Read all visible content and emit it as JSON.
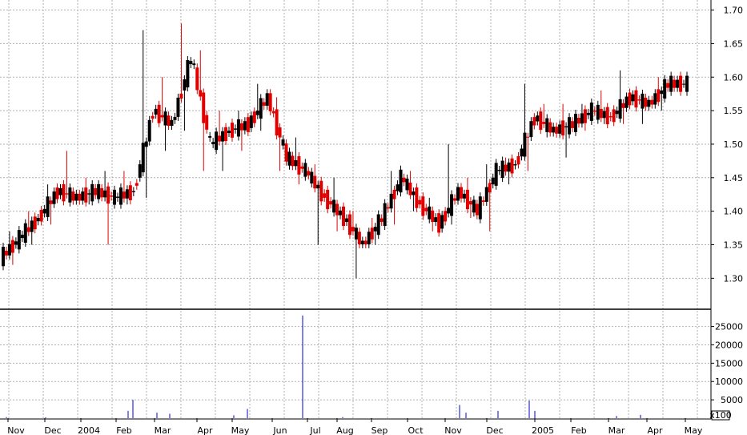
{
  "chart_data": [
    {
      "type": "candlestick",
      "panel": "price",
      "ylim": [
        1.255,
        1.715
      ],
      "y_ticks": [
        1.3,
        1.35,
        1.4,
        1.45,
        1.5,
        1.55,
        1.6,
        1.65,
        1.7
      ],
      "y_tick_labels": [
        "1.30",
        "1.35",
        "1.40",
        "1.45",
        "1.50",
        "1.55",
        "1.60",
        "1.65",
        "1.70"
      ],
      "up_color": "#000000",
      "down_color": "#e00000",
      "grid": true,
      "months_approx": [
        {
          "label": "Nov",
          "open": 1.33,
          "high": 1.37,
          "low": 1.32,
          "close": 1.36
        },
        {
          "label": "Nov",
          "open": 1.36,
          "high": 1.4,
          "low": 1.35,
          "close": 1.39
        },
        {
          "label": "Nov",
          "open": 1.39,
          "high": 1.44,
          "low": 1.38,
          "close": 1.43
        },
        {
          "label": "Dec",
          "open": 1.43,
          "high": 1.49,
          "low": 1.41,
          "close": 1.42
        },
        {
          "label": "Dec",
          "open": 1.42,
          "high": 1.45,
          "low": 1.41,
          "close": 1.43
        },
        {
          "label": "2004",
          "open": 1.43,
          "high": 1.46,
          "low": 1.35,
          "close": 1.42
        },
        {
          "label": "2004",
          "open": 1.42,
          "high": 1.46,
          "low": 1.41,
          "close": 1.43
        },
        {
          "label": "Feb",
          "open": 1.43,
          "high": 1.67,
          "low": 1.42,
          "close": 1.55
        },
        {
          "label": "Feb",
          "open": 1.55,
          "high": 1.6,
          "low": 1.49,
          "close": 1.53
        },
        {
          "label": "Mar",
          "open": 1.53,
          "high": 1.68,
          "low": 1.52,
          "close": 1.63
        },
        {
          "label": "Mar",
          "open": 1.63,
          "high": 1.64,
          "low": 1.46,
          "close": 1.5
        },
        {
          "label": "Mar",
          "open": 1.5,
          "high": 1.55,
          "low": 1.46,
          "close": 1.52
        },
        {
          "label": "Apr",
          "open": 1.52,
          "high": 1.55,
          "low": 1.49,
          "close": 1.53
        },
        {
          "label": "May",
          "open": 1.53,
          "high": 1.59,
          "low": 1.52,
          "close": 1.57
        },
        {
          "label": "May",
          "open": 1.57,
          "high": 1.57,
          "low": 1.46,
          "close": 1.48
        },
        {
          "label": "Jun",
          "open": 1.48,
          "high": 1.51,
          "low": 1.44,
          "close": 1.46
        },
        {
          "label": "Jun",
          "open": 1.46,
          "high": 1.47,
          "low": 1.35,
          "close": 1.42
        },
        {
          "label": "Jul",
          "open": 1.42,
          "high": 1.45,
          "low": 1.37,
          "close": 1.39
        },
        {
          "label": "Aug",
          "open": 1.39,
          "high": 1.4,
          "low": 1.3,
          "close": 1.35
        },
        {
          "label": "Aug",
          "open": 1.35,
          "high": 1.39,
          "low": 1.35,
          "close": 1.39
        },
        {
          "label": "Sep",
          "open": 1.39,
          "high": 1.46,
          "low": 1.38,
          "close": 1.45
        },
        {
          "label": "Sep",
          "open": 1.45,
          "high": 1.46,
          "low": 1.4,
          "close": 1.41
        },
        {
          "label": "Oct",
          "open": 1.41,
          "high": 1.42,
          "low": 1.37,
          "close": 1.38
        },
        {
          "label": "Nov",
          "open": 1.38,
          "high": 1.5,
          "low": 1.38,
          "close": 1.43
        },
        {
          "label": "Nov",
          "open": 1.43,
          "high": 1.45,
          "low": 1.39,
          "close": 1.4
        },
        {
          "label": "Dec",
          "open": 1.4,
          "high": 1.47,
          "low": 1.37,
          "close": 1.46
        },
        {
          "label": "Dec",
          "open": 1.46,
          "high": 1.48,
          "low": 1.44,
          "close": 1.47
        },
        {
          "label": "2005",
          "open": 1.47,
          "high": 1.59,
          "low": 1.46,
          "close": 1.54
        },
        {
          "label": "2005",
          "open": 1.54,
          "high": 1.56,
          "low": 1.51,
          "close": 1.52
        },
        {
          "label": "Feb",
          "open": 1.52,
          "high": 1.56,
          "low": 1.48,
          "close": 1.53
        },
        {
          "label": "Feb",
          "open": 1.53,
          "high": 1.56,
          "low": 1.52,
          "close": 1.55
        },
        {
          "label": "Mar",
          "open": 1.55,
          "high": 1.58,
          "low": 1.53,
          "close": 1.54
        },
        {
          "label": "Mar",
          "open": 1.54,
          "high": 1.61,
          "low": 1.53,
          "close": 1.57
        },
        {
          "label": "Apr",
          "open": 1.57,
          "high": 1.57,
          "low": 1.53,
          "close": 1.56
        },
        {
          "label": "Apr",
          "open": 1.56,
          "high": 1.6,
          "low": 1.55,
          "close": 1.59
        },
        {
          "label": "May",
          "open": 1.59,
          "high": 1.6,
          "low": 1.58,
          "close": 1.59
        }
      ]
    },
    {
      "type": "bar",
      "panel": "volume",
      "color": "#0000cc",
      "ylim": [
        0,
        29500
      ],
      "y_ticks": [
        5000,
        10000,
        15000,
        20000,
        25000
      ],
      "y_tick_labels": [
        "5000",
        "10000",
        "15000",
        "20000",
        "25000"
      ],
      "unit_label": "x100",
      "volumes": [
        {
          "label": "Nov",
          "value": 300
        },
        {
          "label": "Dec",
          "value": 250
        },
        {
          "label": "Feb",
          "value": 2000
        },
        {
          "label": "Feb",
          "value": 5000
        },
        {
          "label": "Mar",
          "value": 1500
        },
        {
          "label": "Mar",
          "value": 1200
        },
        {
          "label": "May",
          "value": 800
        },
        {
          "label": "May",
          "value": 2500
        },
        {
          "label": "Jun",
          "value": 28000
        },
        {
          "label": "Aug",
          "value": 300
        },
        {
          "label": "Nov",
          "value": 3600
        },
        {
          "label": "Nov",
          "value": 1500
        },
        {
          "label": "Dec",
          "value": 2000
        },
        {
          "label": "2005",
          "value": 4800
        },
        {
          "label": "2005",
          "value": 2000
        },
        {
          "label": "Mar",
          "value": 600
        },
        {
          "label": "Apr",
          "value": 900
        }
      ]
    }
  ],
  "x_axis": {
    "labels": [
      "Nov",
      "Dec",
      "2004",
      "Feb",
      "Mar",
      "Apr",
      "May",
      "Jun",
      "Jul",
      "Aug",
      "Sep",
      "Oct",
      "Nov",
      "Dec",
      "2005",
      "Feb",
      "Mar",
      "Apr",
      "May"
    ]
  }
}
